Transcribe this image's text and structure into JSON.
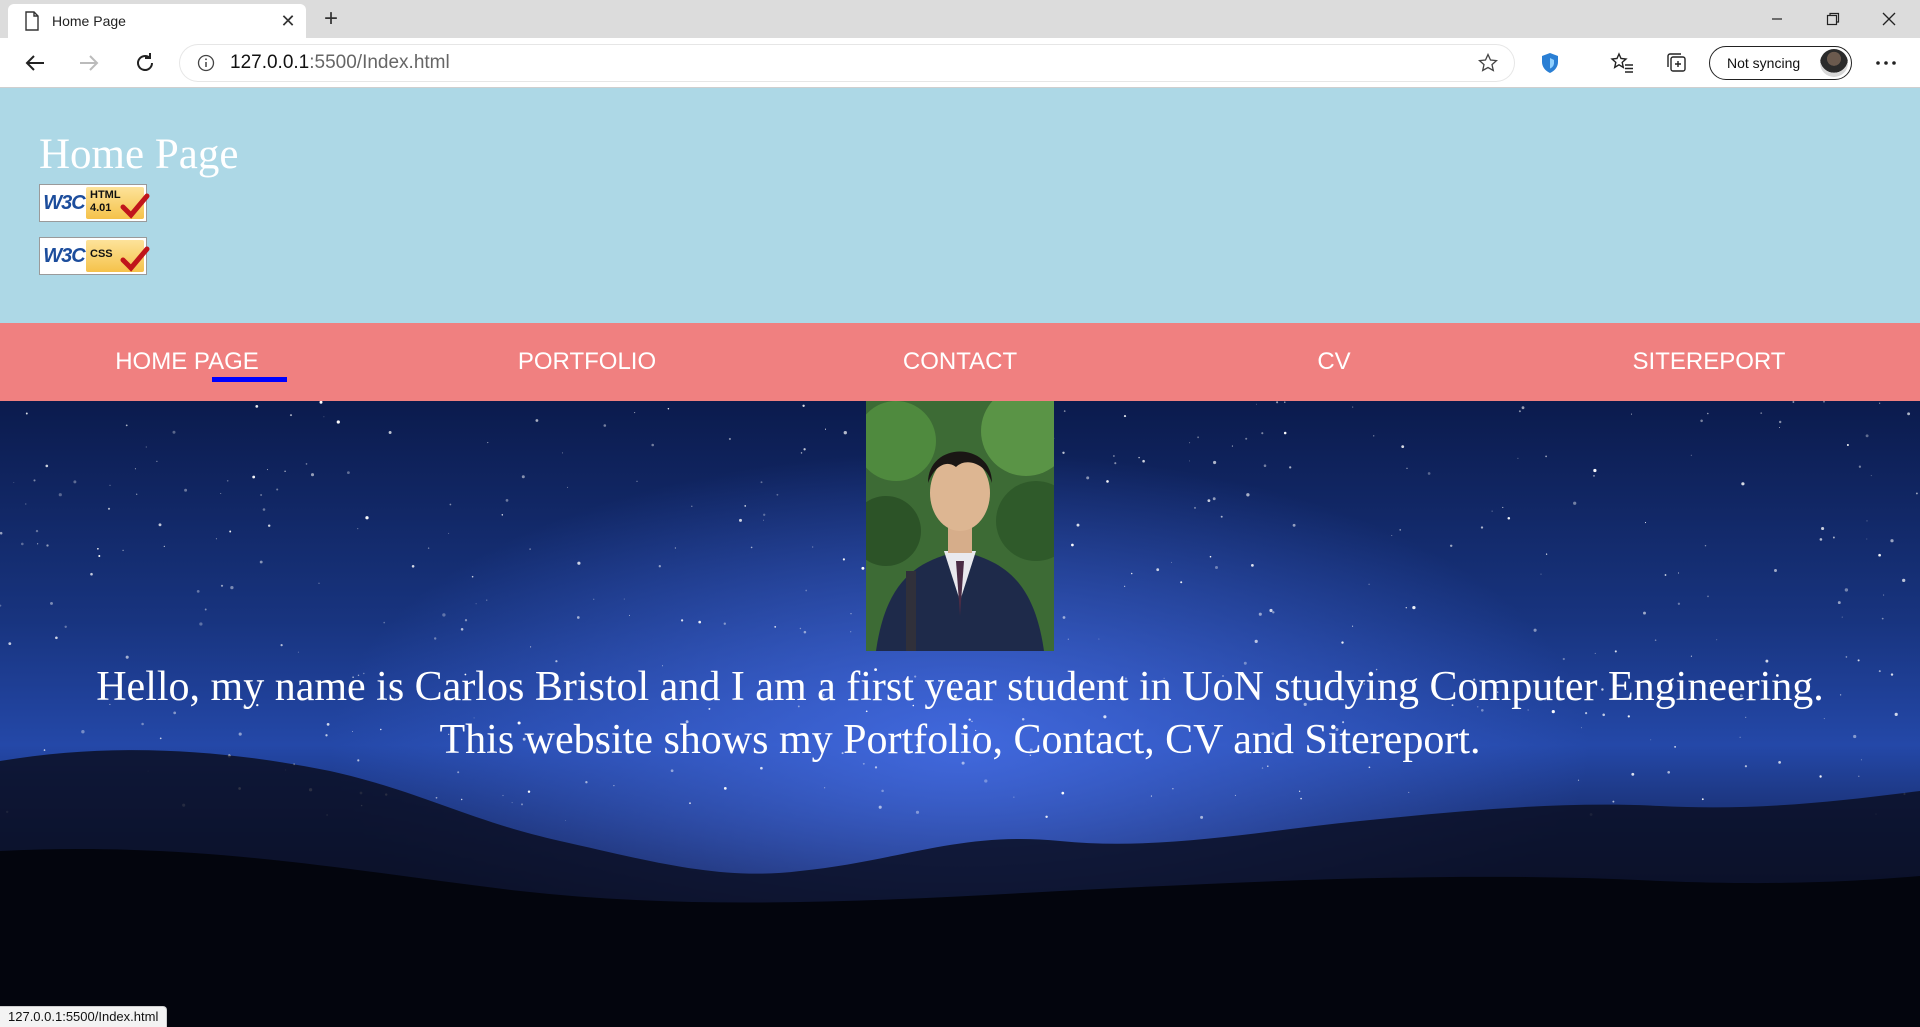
{
  "browser": {
    "tab_title": "Home Page",
    "url_host": "127.0.0.1",
    "url_path": ":5500/Index.html",
    "sync_label": "Not syncing",
    "status_url": "127.0.0.1:5500/Index.html",
    "icons": [
      "page-icon",
      "close-icon",
      "plus-icon",
      "minimize-icon",
      "restore-icon",
      "window-close-icon",
      "back-arrow-icon",
      "forward-arrow-icon",
      "refresh-icon",
      "info-icon",
      "star-icon",
      "shield-icon",
      "favorites-icon",
      "collections-icon",
      "ellipsis-icon"
    ]
  },
  "header": {
    "title": "Home Page",
    "badges": [
      {
        "w3c": "W3C",
        "text_line1": "HTML",
        "text_line2": "4.01"
      },
      {
        "w3c": "W3C",
        "text_line1": "CSS",
        "text_line2": ""
      }
    ],
    "background": "#add8e6"
  },
  "nav": {
    "background": "#f08080",
    "active_underline": "#0000ff",
    "items": [
      {
        "label": "HOME PAGE"
      },
      {
        "label": "PORTFOLIO"
      },
      {
        "label": "CONTACT"
      },
      {
        "label": "CV"
      },
      {
        "label": "SITEREPORT"
      }
    ]
  },
  "main": {
    "intro_line1": "Hello, my name is Carlos Bristol and I am a first year student in UoN studying Computer Engineering.",
    "intro_line2": "This website shows my Portfolio, Contact, CV and Sitereport."
  }
}
